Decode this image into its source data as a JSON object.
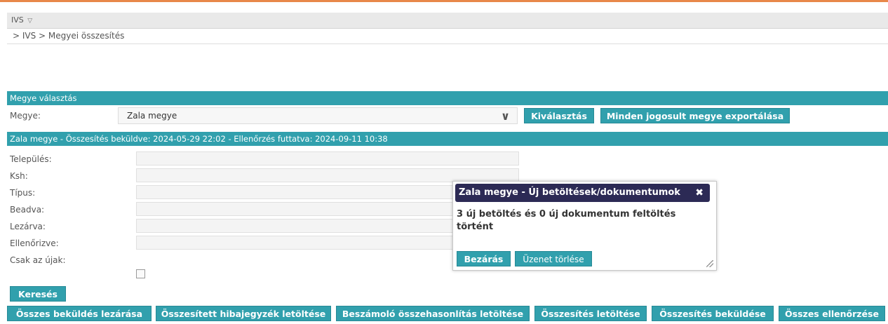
{
  "menu": {
    "app_label": "IVS",
    "chevron": "▽"
  },
  "breadcrumb": "> IVS > Megyei összesítés",
  "county_section": {
    "header": "Megye választás",
    "county_label": "Megye:",
    "county_value": "Zala megye",
    "select_button": "Kiválasztás",
    "export_button": "Minden jogosult megye exportálása"
  },
  "summary_bar": "Zala megye - Összesítés beküldve: 2024-05-29 22:02 - Ellenőrzés futtatva: 2024-09-11 10:38",
  "filters": {
    "telepules": "Település:",
    "ksh": "Ksh:",
    "tipus": "Típus:",
    "beadva": "Beadva:",
    "lezarva": "Lezárva:",
    "ellenorizve": "Ellenőrizve:",
    "csak_ujak": "Csak az újak:",
    "search_button": "Keresés"
  },
  "actions": [
    "Összes beküldés lezárása",
    "Összesített hibajegyzék letöltése",
    "Beszámoló összehasonlítás letöltése",
    "Összesítés letöltése",
    "Összesítés beküldése",
    "Összes ellenőrzése"
  ],
  "dialog": {
    "title": "Zala megye - Új betöltések/dokumentumok",
    "close": "✖",
    "message": "3 új betöltés és 0 új dokumentum feltöltés történt",
    "close_button": "Bezárás",
    "delete_button": "Üzenet törlése"
  },
  "colors": {
    "accent": "#31a0ad",
    "dialog_header": "#2c2a55",
    "top_line": "#e8884a"
  }
}
